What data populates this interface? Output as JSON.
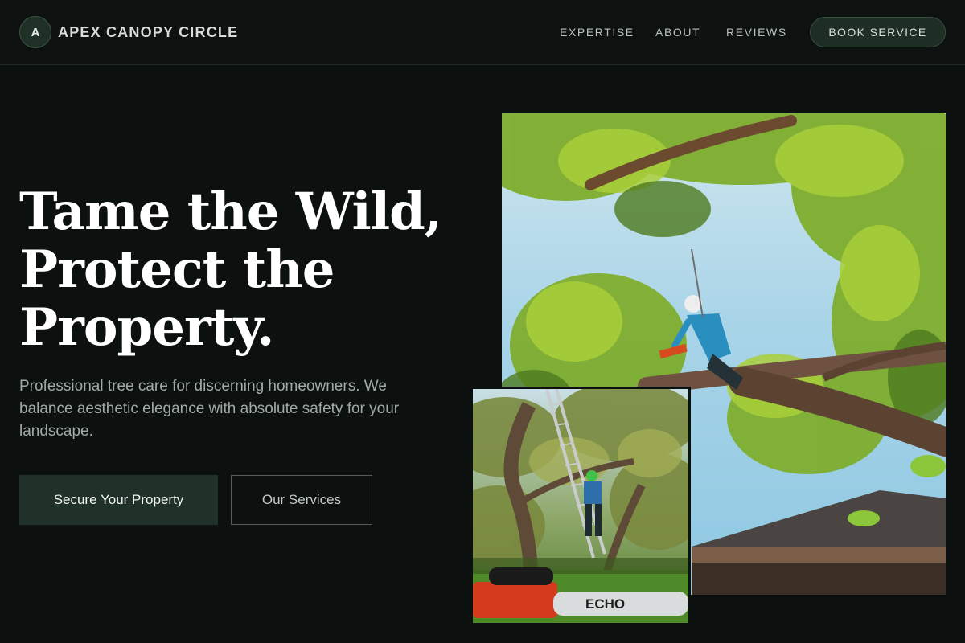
{
  "nav": {
    "logo_letter": "A",
    "brand": "APEX CANOPY CIRCLE",
    "links": [
      "EXPERTISE",
      "ABOUT",
      "REVIEWS"
    ],
    "cta": "BOOK SERVICE"
  },
  "hero": {
    "headline_lines": [
      "Tame the Wild,",
      "Protect the",
      "Property."
    ],
    "subtext": "Professional tree care for discerning homeowners. We balance aesthetic elegance with absolute safety for your landscape.",
    "primary_button": "Secure Your Property",
    "secondary_button": "Our Services"
  },
  "images": {
    "main": "arborist-climbing-tree-photo",
    "inset": "arborist-on-ladder-with-chainsaw-photo",
    "chainsaw_brand": "ECHO"
  },
  "colors": {
    "background": "#0c100e",
    "accent": "#1f3128",
    "text_muted": "#a2aaa6"
  }
}
